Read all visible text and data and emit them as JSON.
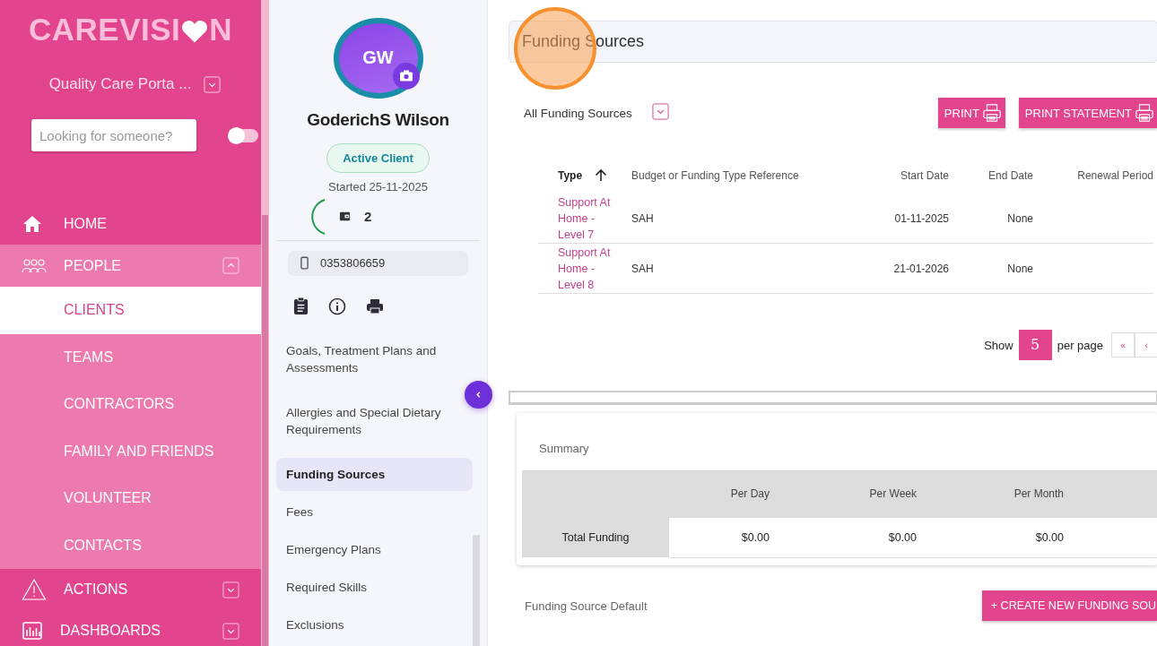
{
  "sidebar": {
    "logo": {
      "text_before": "CAREVISI",
      "text_after": "N"
    },
    "organisation": "Quality Care Porta ...",
    "search": {
      "placeholder": "Looking for someone?"
    },
    "toggle": {
      "on": false
    },
    "nav": [
      {
        "label": "HOME"
      },
      {
        "label": "PEOPLE",
        "expanded": true,
        "children": [
          {
            "label": "CLIENTS",
            "selected": true
          },
          {
            "label": "TEAMS",
            "selected": false
          },
          {
            "label": "CONTRACTORS",
            "selected": false
          },
          {
            "label": "FAMILY AND FRIENDS",
            "selected": false
          },
          {
            "label": "VOLUNTEER",
            "selected": false
          },
          {
            "label": "CONTACTS",
            "selected": false
          }
        ]
      },
      {
        "label": "ACTIONS",
        "expanded": false
      },
      {
        "label": "DASHBOARDS",
        "expanded": false
      }
    ]
  },
  "client": {
    "initials": "GW",
    "name": "GoderichS Wilson",
    "status": "Active Client",
    "started": "Started 25-11-2025",
    "wallet_count": "2",
    "phone": "0353806659",
    "menu": [
      {
        "label": "Goals, Treatment Plans and Assessments",
        "selected": false
      },
      {
        "label": "Allergies and Special Dietary Requirements",
        "selected": false
      },
      {
        "label": "Funding Sources",
        "selected": true
      },
      {
        "label": "Fees",
        "selected": false
      },
      {
        "label": "Emergency Plans",
        "selected": false
      },
      {
        "label": "Required Skills",
        "selected": false
      },
      {
        "label": "Exclusions",
        "selected": false
      }
    ]
  },
  "main": {
    "title": "Funding Sources",
    "filter": "All Funding Sources",
    "buttons": [
      "PRINT",
      "PRINT STATEMENT"
    ],
    "table": {
      "columns": [
        {
          "label": "Type",
          "sorted": true
        },
        {
          "label": "Budget or Funding Type Reference",
          "sorted": false
        },
        {
          "label": "Start Date",
          "sorted": false
        },
        {
          "label": "End Date",
          "sorted": false
        },
        {
          "label": "Renewal Period",
          "sorted": false
        }
      ],
      "rows": [
        [
          "Support At Home - Level 7",
          "SAH",
          "01-11-2025",
          "None"
        ],
        [
          "Support At Home - Level 8",
          "SAH",
          "21-01-2026",
          "None"
        ]
      ]
    },
    "pagination": {
      "label_before": "Show",
      "per_page": "5",
      "label_after": "per page",
      "buttons": [
        "«",
        "‹"
      ]
    },
    "summary": {
      "title": "Summary",
      "columns": [
        "Per Day",
        "Per Week",
        "Per Month"
      ],
      "rows": [
        {
          "label": "Total Funding",
          "values": [
            "$0.00",
            "$0.00",
            "$0.00"
          ]
        }
      ]
    },
    "default_label": "Funding Source Default",
    "create_button": "+ CREATE NEW FUNDING SOU"
  }
}
